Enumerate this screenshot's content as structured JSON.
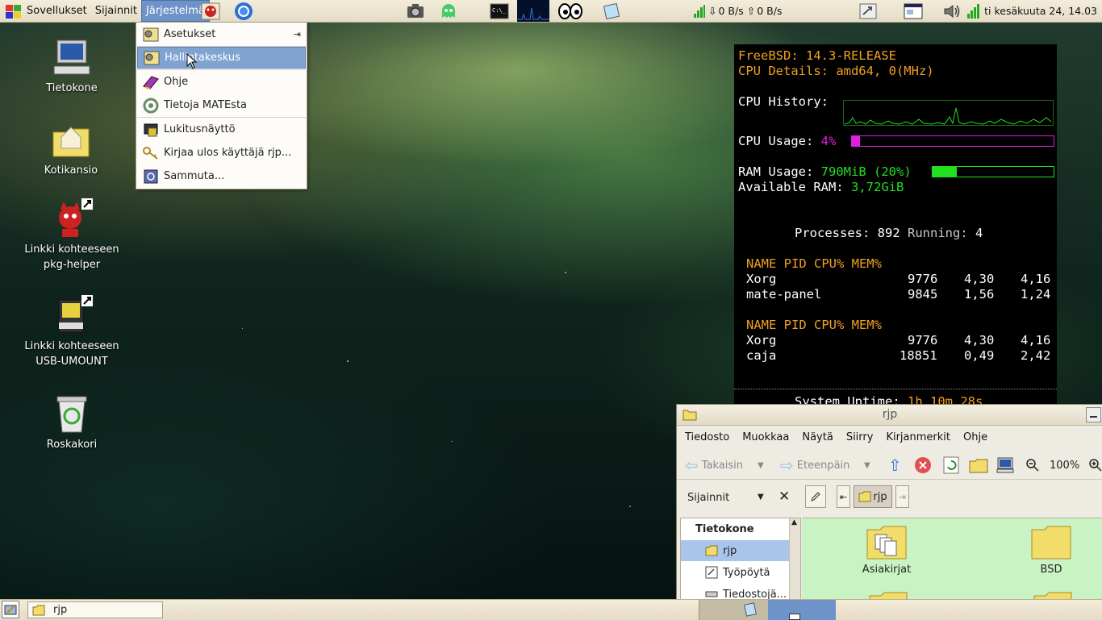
{
  "top_panel": {
    "menus": [
      "Sovellukset",
      "Sijainnit",
      "Järjestelmä"
    ],
    "network": {
      "down": "0 B/s",
      "up": "0 B/s"
    },
    "clock": "ti kesäkuuta 24, 14.03"
  },
  "system_menu": {
    "items": [
      "Asetukset",
      "Hallintakeskus",
      "Ohje",
      "Tietoja MATEsta",
      "Lukitusnäyttö",
      "Kirjaa ulos käyttäjä rjp...",
      "Sammuta..."
    ],
    "highlighted": "Hallintakeskus"
  },
  "desktop_icons": [
    {
      "label": "Tietokone"
    },
    {
      "label": "Kotikansio"
    },
    {
      "label": "Linkki kohteeseen pkg-helper"
    },
    {
      "label": "Linkki kohteeseen USB-UMOUNT"
    },
    {
      "label": "Roskakori"
    }
  ],
  "conky": {
    "os": "FreeBSD: 14.3-RELEASE",
    "cpu_details": "CPU Details: amd64, 0(MHz)",
    "cpu_history_label": "CPU History:",
    "cpu_usage_label": "CPU Usage:",
    "cpu_usage": "4%",
    "cpu_usage_fraction": 0.04,
    "ram_label": "RAM Usage:",
    "ram_value": "790MiB (20%)",
    "ram_fraction": 0.2,
    "avail_label": "Available RAM:",
    "avail_value": "3,72GiB",
    "processes_label": "Processes:",
    "processes": "892",
    "running_label": "Running:",
    "running": "4",
    "table_header": "NAME PID CPU% MEM%",
    "top_cpu": [
      {
        "name": "Xorg",
        "pid": "9776",
        "cpu": "4,30",
        "mem": "4,16"
      },
      {
        "name": "mate-panel",
        "pid": "9845",
        "cpu": "1,56",
        "mem": "1,24"
      }
    ],
    "top_mem": [
      {
        "name": "Xorg",
        "pid": "9776",
        "cpu": "4,30",
        "mem": "4,16"
      },
      {
        "name": "caja",
        "pid": "18851",
        "cpu": "0,49",
        "mem": "2,42"
      }
    ],
    "uptime_label": "System Uptime:",
    "uptime_value": "1h 10m 28s"
  },
  "file_manager": {
    "title": "rjp",
    "menubar": [
      "Tiedosto",
      "Muokkaa",
      "Näytä",
      "Siirry",
      "Kirjanmerkit",
      "Ohje"
    ],
    "toolbar": {
      "back": "Takaisin",
      "forward": "Eteenpäin",
      "zoom": "100%"
    },
    "sidebar_title": "Sijainnit",
    "path_button": "rjp",
    "sidebar": {
      "heading": "Tietokone",
      "items": [
        "rjp",
        "Työpöytä",
        "Tiedostojä..."
      ]
    },
    "files": [
      "Asiakirjat",
      "BSD"
    ]
  },
  "bottom_panel": {
    "task": "rjp"
  }
}
